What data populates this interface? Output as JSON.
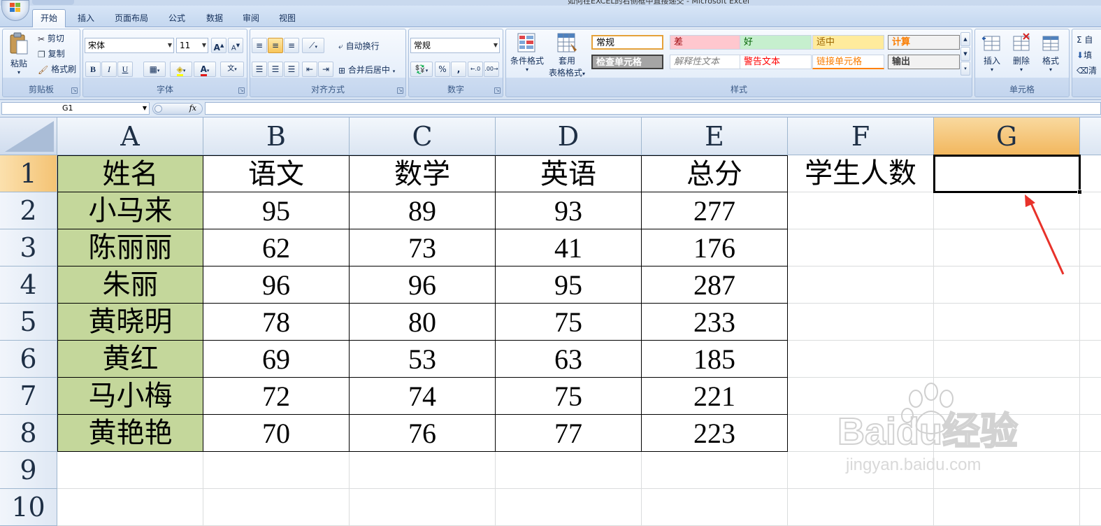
{
  "window": {
    "title": "如何在EXCEL的右侧框中直接递交 - Microsoft Excel"
  },
  "tabs": [
    "开始",
    "插入",
    "页面布局",
    "公式",
    "数据",
    "审阅",
    "视图"
  ],
  "ribbon": {
    "clipboard": {
      "label": "剪贴板",
      "paste": "粘贴",
      "cut": "剪切",
      "copy": "复制",
      "format_painter": "格式刷"
    },
    "font": {
      "label": "字体",
      "name": "宋体",
      "size": "11",
      "bold": "B",
      "italic": "I",
      "underline": "U"
    },
    "alignment": {
      "label": "对齐方式",
      "wrap": "自动换行",
      "merge": "合并后居中"
    },
    "number": {
      "label": "数字",
      "format": "常规",
      "percent": "%",
      "comma": ","
    },
    "styles": {
      "label": "样式",
      "conditional": "条件格式",
      "table_format_1": "套用",
      "table_format_2": "表格格式",
      "gallery": [
        {
          "name": "常规",
          "bg": "#ffffff",
          "fg": "#000000"
        },
        {
          "name": "差",
          "bg": "#ffc7ce",
          "fg": "#9c0006"
        },
        {
          "name": "好",
          "bg": "#c6efce",
          "fg": "#006100"
        },
        {
          "name": "适中",
          "bg": "#ffeb9c",
          "fg": "#9c6500"
        },
        {
          "name": "计算",
          "bg": "#f2f2f2",
          "fg": "#fa7d00"
        },
        {
          "name": "检查单元格",
          "bg": "#a5a5a5",
          "fg": "#ffffff"
        },
        {
          "name": "解释性文本",
          "bg": "#ffffff",
          "fg": "#7f7f7f"
        },
        {
          "name": "警告文本",
          "bg": "#ffffff",
          "fg": "#ff0000"
        },
        {
          "name": "链接单元格",
          "bg": "#ffffff",
          "fg": "#fa7d00"
        },
        {
          "name": "输出",
          "bg": "#f2f2f2",
          "fg": "#3f3f3f"
        }
      ]
    },
    "cells": {
      "label": "单元格",
      "insert": "插入",
      "delete": "删除",
      "format": "格式"
    },
    "editing": {
      "sum": "Σ 自",
      "fill": "填",
      "clear": "清"
    }
  },
  "formula_bar": {
    "name_box": "G1",
    "fx": "fx",
    "value": ""
  },
  "sheet": {
    "columns": [
      "A",
      "B",
      "C",
      "D",
      "E",
      "F",
      "G"
    ],
    "rows": [
      "1",
      "2",
      "3",
      "4",
      "5",
      "6",
      "7",
      "8",
      "9",
      "10"
    ],
    "header": [
      "姓名",
      "语文",
      "数学",
      "英语",
      "总分",
      "学生人数",
      ""
    ],
    "data": [
      [
        "小马来",
        "95",
        "89",
        "93",
        "277"
      ],
      [
        "陈丽丽",
        "62",
        "73",
        "41",
        "176"
      ],
      [
        "朱丽",
        "96",
        "96",
        "95",
        "287"
      ],
      [
        "黄晓明",
        "78",
        "80",
        "75",
        "233"
      ],
      [
        "黄红",
        "69",
        "53",
        "63",
        "185"
      ],
      [
        "马小梅",
        "72",
        "74",
        "75",
        "221"
      ],
      [
        "黄艳艳",
        "70",
        "76",
        "77",
        "223"
      ]
    ],
    "selected_cell": "G1",
    "name_fill_color": "#c4d79b"
  },
  "watermark": {
    "brand": "Baidu经验",
    "url": "jingyan.baidu.com"
  },
  "annotation": {
    "type": "arrow",
    "color": "#e8322a"
  }
}
